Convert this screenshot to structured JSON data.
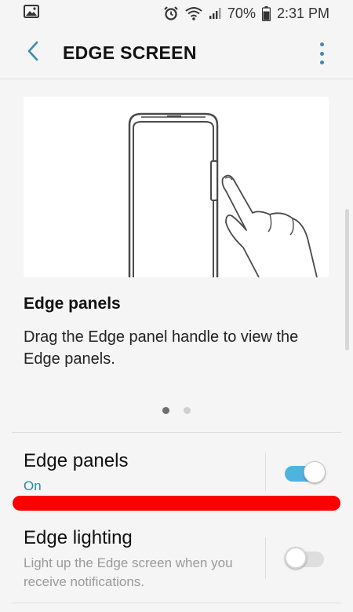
{
  "status": {
    "battery": "70%",
    "time": "2:31 PM"
  },
  "header": {
    "title": "EDGE SCREEN"
  },
  "card": {
    "title": "Edge panels",
    "description": "Drag the Edge panel handle to view the Edge panels."
  },
  "settings": {
    "edge_panels": {
      "title": "Edge panels",
      "status": "On",
      "enabled": true
    },
    "edge_lighting": {
      "title": "Edge lighting",
      "description": "Light up the Edge screen when you receive notifications.",
      "enabled": false
    }
  },
  "colors": {
    "accent": "#3d8cb0",
    "switch_on": "#4fb3df",
    "status_on_text": "#1e8fa6",
    "annotation_red": "#ff0000"
  },
  "icons": [
    "gallery-icon",
    "alarm-icon",
    "wifi-icon",
    "signal-icon",
    "battery-icon",
    "back-arrow-icon",
    "more-options-icon"
  ],
  "pager": {
    "pages": 2,
    "current": 1
  }
}
